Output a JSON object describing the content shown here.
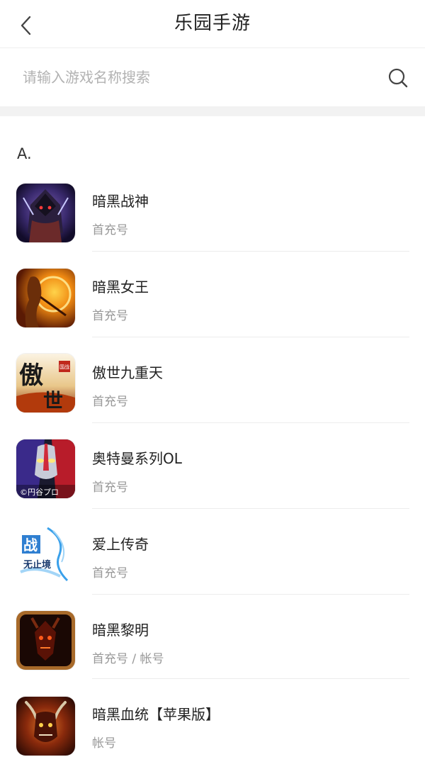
{
  "header": {
    "title": "乐园手游"
  },
  "search": {
    "placeholder": "请输入游戏名称搜索",
    "value": ""
  },
  "section": {
    "letter": "A."
  },
  "games": [
    {
      "name": "暗黑战神",
      "tag": "首充号",
      "icon": "dark-war-god-icon"
    },
    {
      "name": "暗黑女王",
      "tag": "首充号",
      "icon": "dark-queen-icon"
    },
    {
      "name": "傲世九重天",
      "tag": "首充号",
      "icon": "aoshi-icon",
      "icon_text": [
        "傲",
        "世"
      ],
      "icon_badge": "国战"
    },
    {
      "name": "奥特曼系列OL",
      "tag": "首充号",
      "icon": "ultraman-icon",
      "icon_text": "©円谷プロ"
    },
    {
      "name": "爱上传奇",
      "tag": "首充号",
      "icon": "love-legend-icon",
      "icon_text": [
        "战",
        "无止境"
      ]
    },
    {
      "name": "暗黑黎明",
      "tag": "首充号 / 帐号",
      "icon": "dark-dawn-icon"
    },
    {
      "name": "暗黑血统【苹果版】",
      "tag": "帐号",
      "icon": "darksiders-icon"
    }
  ]
}
